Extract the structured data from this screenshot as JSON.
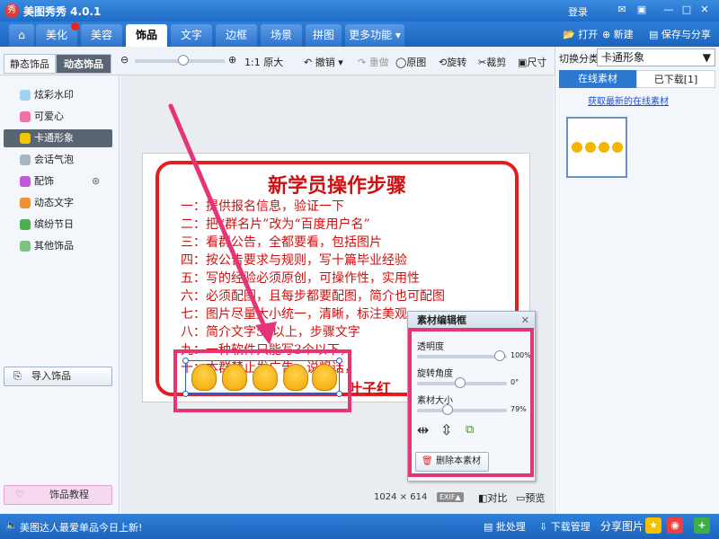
{
  "app": {
    "title": "美图秀秀 4.0.1",
    "login": "登录",
    "logo_char": "秀"
  },
  "tabs": [
    {
      "label": "⌂"
    },
    {
      "label": "美化"
    },
    {
      "label": "美容"
    },
    {
      "label": "饰品"
    },
    {
      "label": "文字"
    },
    {
      "label": "边框"
    },
    {
      "label": "场景"
    },
    {
      "label": "拼图"
    },
    {
      "label": "更多功能 ▾"
    }
  ],
  "top_actions": {
    "open": "打开",
    "new": "新建",
    "save_share": "保存与分享"
  },
  "subtabs": {
    "static": "静态饰品",
    "dynamic": "动态饰品"
  },
  "toolbar": {
    "original_size": "1:1 原大",
    "undo": "撤销",
    "redo": "重做",
    "original": "原图",
    "rotate": "旋转",
    "crop": "裁剪",
    "size": "尺寸"
  },
  "categories": [
    {
      "label": "炫彩水印"
    },
    {
      "label": "可爱心"
    },
    {
      "label": "卡通形象"
    },
    {
      "label": "会话气泡"
    },
    {
      "label": "配饰"
    },
    {
      "label": "动态文字"
    },
    {
      "label": "缤纷节日"
    },
    {
      "label": "其他饰品"
    }
  ],
  "import_btn": "导入饰品",
  "tutorial_btn": "饰品教程",
  "right": {
    "switch_label": "切换分类",
    "category_value": "卡通形象",
    "tab_online": "在线素材",
    "tab_downloaded": "已下载[1]",
    "get_latest": "获取最新的在线素材"
  },
  "poster": {
    "title": "新学员操作步骤",
    "lines": [
      "一：提供报名信息，验证一下",
      "二：把“群名片”改为“百度用户名”",
      "三：看群公告，全都要看，包括图片",
      "四：按公告要求与规则，写十篇毕业经验",
      "五：写的经验必须原创，可操作性，实用性",
      "六：必须配图，且每步都要配图，简介也可配图",
      "七：图片尽量大小统一，清晰，标注美观",
      "八：简介文字50以上，步骤文字",
      "九：一种软件只能写3个以下，",
      "十：本群禁止发广告，说粗话，"
    ],
    "signature": "叶子红"
  },
  "dialog": {
    "title": "素材编辑框",
    "opacity_label": "透明度",
    "opacity_value": "100%",
    "rotate_label": "旋转角度",
    "rotate_value": "0°",
    "size_label": "素材大小",
    "size_value": "79%",
    "delete_label": "删除本素材"
  },
  "image_info": {
    "width": "1024",
    "x": "×",
    "height": "614",
    "exif": "EXIF▲",
    "compare": "对比",
    "preview": "预览"
  },
  "status": {
    "message": "美图达人最爱单品今日上新!",
    "batch": "批处理",
    "download_mgr": "下载管理",
    "share": "分享图片"
  },
  "colors": {
    "accent": "#1f6bc7",
    "highlight": "#e63577",
    "poster_red": "#d01010"
  }
}
